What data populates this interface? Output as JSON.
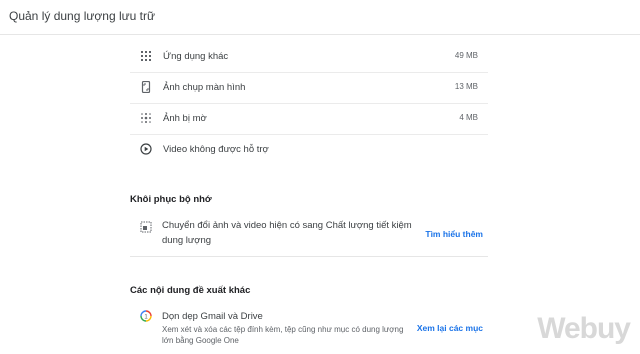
{
  "header": {
    "title": "Quản lý dung lượng lưu trữ"
  },
  "storage_items": [
    {
      "icon": "apps-grid-icon",
      "label": "Ứng dụng khác",
      "size": "49 MB"
    },
    {
      "icon": "phone-screenshot-icon",
      "label": "Ảnh chụp màn hình",
      "size": "13 MB"
    },
    {
      "icon": "blur-icon",
      "label": "Ảnh bị mờ",
      "size": "4 MB"
    },
    {
      "icon": "play-circle-icon",
      "label": "Video không được hỗ trợ",
      "size": ""
    }
  ],
  "recover": {
    "title": "Khôi phục bộ nhớ",
    "text": "Chuyển đổi ảnh và video hiện có sang Chất lượng tiết kiệm dung lượng",
    "link": "Tìm hiểu thêm"
  },
  "suggestions": {
    "title": "Các nội dung đề xuất khác",
    "item_title": "Dọn dẹp Gmail và Drive",
    "item_sub": "Xem xét và xóa các tệp đính kèm, tệp cũng như mục có dung lượng lớn bằng Google One",
    "link": "Xem lại các mục"
  },
  "watermark": "Webuy",
  "colors": {
    "link": "#1a73e8",
    "divider": "#e6e6e6",
    "text": "#3c4043"
  }
}
